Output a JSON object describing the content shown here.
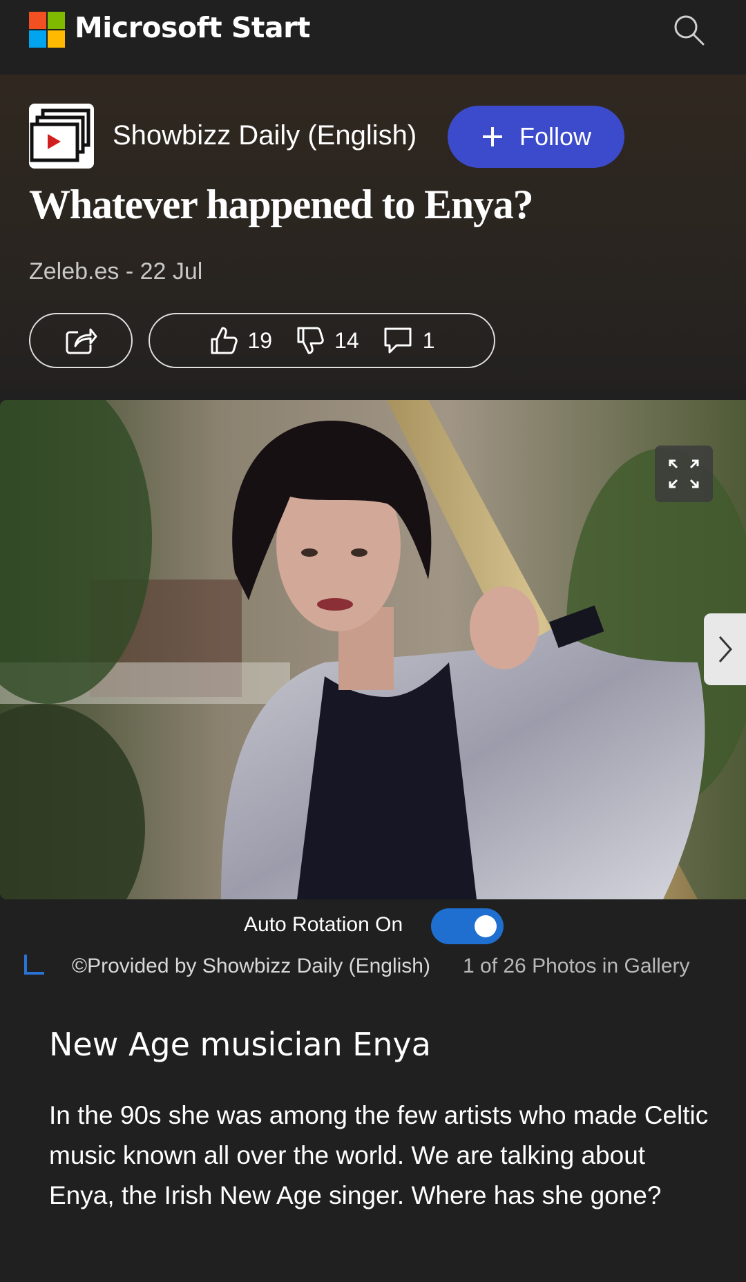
{
  "app": {
    "brand": "Microsoft Start"
  },
  "publisher": {
    "name": "Showbizz Daily (English)",
    "follow_label": "Follow"
  },
  "article": {
    "headline": "Whatever happened to Enya?",
    "meta": "Zeleb.es - 22 Jul",
    "likes": "19",
    "dislikes": "14",
    "comments": "1"
  },
  "gallery": {
    "auto_rotation_label": "Auto Rotation On",
    "auto_rotation_on": true,
    "provided_by": "©Provided by Showbizz Daily (English)",
    "position": "1 of 26 Photos in Gallery",
    "slide_title": "New Age musician Enya",
    "slide_body": "In the 90s she was among the few artists who made Celtic music known all over the world. We are talking about Enya, the Irish New Age singer. Where has she gone?"
  },
  "colors": {
    "follow": "#3c4bcc",
    "toggle": "#1f6fd0"
  }
}
